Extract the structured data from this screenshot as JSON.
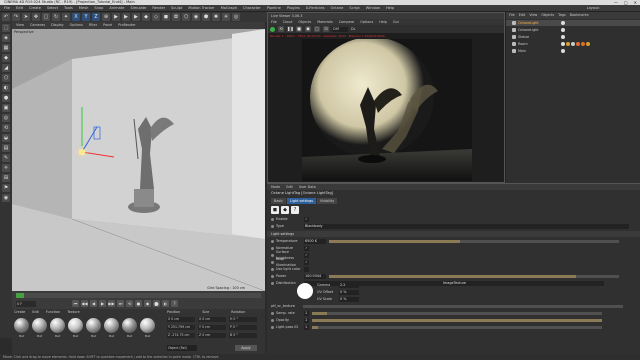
{
  "window": {
    "title": "CINEMA 4D R19.024 Studio (RC - R19) - [Projection_Tutorial_End4] - Main",
    "controls": [
      "—",
      "□",
      "✕"
    ]
  },
  "menubar": [
    "File",
    "Edit",
    "Create",
    "Select",
    "Tools",
    "Mesh",
    "Snap",
    "Animate",
    "Simulate",
    "Render",
    "Sculpt",
    "Motion Tracker",
    "MoGraph",
    "Character",
    "Pipeline",
    "Plugins",
    "X-Particles",
    "Octane",
    "Script",
    "Window",
    "Help"
  ],
  "layout": "Layout:",
  "toolbar": [
    "↶",
    "↷",
    "➤",
    "✥",
    "▢",
    "↻",
    "✦",
    "X",
    "Y",
    "Z",
    "⊕",
    "▶",
    "▶",
    "▶",
    "◆",
    "◇",
    "◼",
    "✿",
    "⬡",
    "◉",
    "⬢",
    "✺",
    "☀",
    "◎"
  ],
  "lefttools": [
    "⬚",
    "◈",
    "▦",
    "◆",
    "◢",
    "⬡",
    "◐",
    "●",
    "▣",
    "◎",
    "⟲",
    "◒",
    "▤",
    "✎",
    "⟡",
    "⊞",
    "⚑",
    "◉"
  ],
  "viewport": {
    "menu": [
      "View",
      "Cameras",
      "Display",
      "Options",
      "Filter",
      "Panel",
      "ProRender"
    ],
    "label": "Perspective",
    "grid_spacing": "Grid Spacing : 100 cm"
  },
  "timeline": {
    "frame": "0 F",
    "controls": [
      "⏮",
      "◀◀",
      "◀",
      "▶",
      "▶▶",
      "⏭",
      "⟲",
      "●",
      "◆",
      "⬤",
      "◐",
      "?"
    ],
    "progress": 0.02
  },
  "materials": {
    "menu": [
      "Create",
      "Edit",
      "Function",
      "Texture"
    ],
    "items": [
      {
        "name": "Mat",
        "color": "#8d8d8d"
      },
      {
        "name": "Mat",
        "color": "#a7a7a7"
      },
      {
        "name": "Mat",
        "color": "#b0b0b0"
      },
      {
        "name": "Mat",
        "color": "#c6c6c6"
      },
      {
        "name": "Mat",
        "color": "#9e9e9e"
      },
      {
        "name": "Mat",
        "color": "#a3a3a3"
      },
      {
        "name": "Mat",
        "color": "#8f8f8f"
      },
      {
        "name": "Mat",
        "color": "#b8b8b8"
      }
    ]
  },
  "coordinates": {
    "headers": [
      "Position",
      "Size",
      "Rotation"
    ],
    "rows": [
      [
        "X  0 cm",
        "X  0 cm",
        "H  0 °"
      ],
      [
        "Y  251.799 cm",
        "Y  0 cm",
        "P  0 °"
      ],
      [
        "Z  -274.75 cm",
        "Z  0 cm",
        "B  0 °"
      ]
    ],
    "mode": "Object (Rel)",
    "apply": "Apply"
  },
  "status": "Move: Click and drag to move elements. Hold down SHIFT to quantize movement / add to the selection in point mode. CTRL to remove.",
  "live_viewer": {
    "title": "Live Viewer 3.06.3",
    "menu": [
      "File",
      "Cloud",
      "Objects",
      "Materials",
      "Compare",
      "Options",
      "Help",
      "Gui"
    ],
    "channel": "DL",
    "info": "Render 1 · 100% · Time: 00:00:04 · Samples: 1024 · Memory 1.30Gb/8.00Gb",
    "preset": "Diff"
  },
  "object_manager": {
    "menu": [
      "File",
      "Edit",
      "View",
      "Objects",
      "Tags",
      "Bookmarks"
    ],
    "objects": [
      {
        "name": "OctaneLight",
        "selected": true
      },
      {
        "name": "OctaneLight",
        "selected": false
      },
      {
        "name": "Statue",
        "selected": false
      },
      {
        "name": "Room",
        "selected": false
      },
      {
        "name": "Main",
        "selected": false
      }
    ]
  },
  "attributes": {
    "menu": [
      "Mode",
      "Edit",
      "User Data"
    ],
    "title": "Octane LightTag [Octane LightTag]",
    "tabs": [
      "Basic",
      "Light settings",
      "Visibility"
    ],
    "active_tab": "Light settings",
    "icons": [
      "◼",
      "◆",
      "?"
    ],
    "enable_label": "Enable",
    "type_label": "Type",
    "type_value": "Blackbody",
    "section_light": "Light settings",
    "rows": [
      {
        "label": "Temperature",
        "value": "6500 K",
        "fill": 0.45
      },
      {
        "label": "Normalize",
        "value": "✓",
        "fill": null
      },
      {
        "label": "Surface brightness",
        "value": "✓",
        "fill": null
      },
      {
        "label": "Keep Illumination",
        "value": "✓",
        "fill": null
      },
      {
        "label": "Use light color",
        "value": "",
        "fill": null
      },
      {
        "label": "Power",
        "value": "100.9344",
        "fill": 0.85
      },
      {
        "label": "Distribution",
        "value": "ImageTexture",
        "fill": null
      }
    ],
    "dist": {
      "gamma_label": "Gamma",
      "gamma_value": "2.2",
      "row_offset_label": "UV Offset",
      "row_offset_value": "0 %",
      "row_scale_label": "UV Scale",
      "row_scale_value": "0 %",
      "name": "ptf_sc_texture"
    },
    "rows2": [
      {
        "label": "Samp. rate",
        "value": "1",
        "fill": 0.05
      },
      {
        "label": "Opacity",
        "value": "1",
        "fill": 1.0
      },
      {
        "label": "Light pass ID",
        "value": "1",
        "fill": 0.02
      }
    ]
  }
}
